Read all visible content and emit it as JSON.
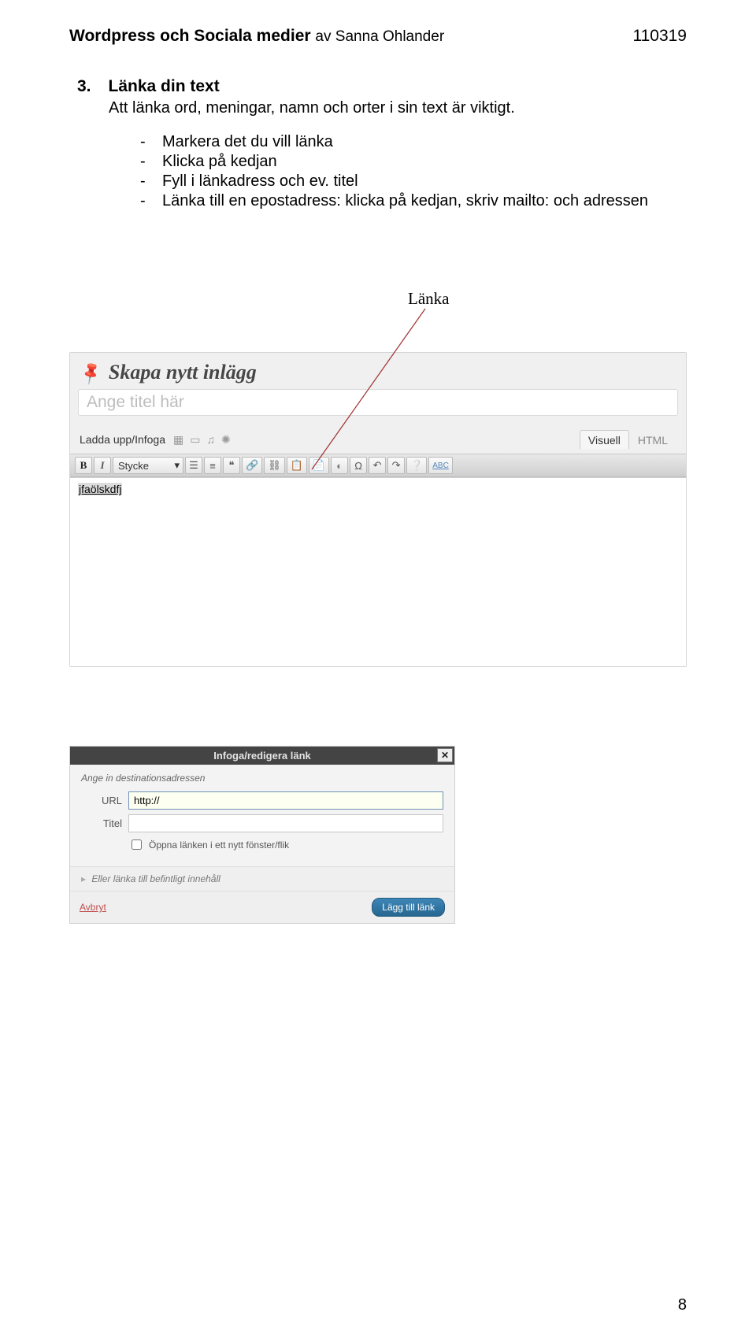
{
  "header": {
    "title_bold": "Wordpress och Sociala medier",
    "byline_prefix": "av ",
    "author": "Sanna Ohlander",
    "date": "110319"
  },
  "section": {
    "number": "3.",
    "title": "Länka din text",
    "intro": "Att länka ord, meningar, namn och orter i sin text är viktigt.",
    "bullets": [
      "Markera det du vill länka",
      "Klicka på kedjan",
      "Fyll i länkadress och ev. titel",
      "Länka till en epostadress: klicka på kedjan, skriv mailto: och adressen"
    ],
    "callout_label": "Länka"
  },
  "editor": {
    "panel_title": "Skapa nytt inlägg",
    "title_placeholder": "Ange titel här",
    "upload_label": "Ladda upp/Infoga",
    "tabs": {
      "visual": "Visuell",
      "html": "HTML"
    },
    "toolbar": {
      "bold": "B",
      "italic": "I",
      "style_select": "Stycke",
      "quotes": "❝",
      "abc": "ABC"
    },
    "selected_text": "jfaölskdfj"
  },
  "link_dialog": {
    "title": "Infoga/redigera länk",
    "section_label": "Ange in destinationsadressen",
    "url_label": "URL",
    "url_value": "http://",
    "title_label": "Titel",
    "title_value": "",
    "newtab_label": "Öppna länken i ett nytt fönster/flik",
    "expand_label": "Eller länka till befintligt innehåll",
    "cancel": "Avbryt",
    "submit": "Lägg till länk"
  },
  "page_number": "8"
}
